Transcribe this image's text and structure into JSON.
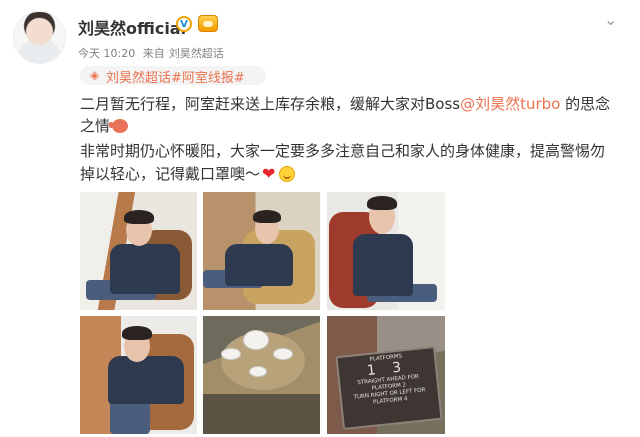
{
  "post": {
    "username": "刘昊然official",
    "verified_mark": "V",
    "meta": {
      "time": "今天 10:20",
      "from_label": "来自",
      "source": "刘昊然超话"
    },
    "topic_tag": "刘昊然超话#阿室线报#",
    "content": {
      "line1_before": "二月暂无行程，阿室赶来送上库存余粮，缓解大家对Boss",
      "mention": "@刘昊然turbo",
      "line1_after": " 的思念",
      "line2": "之情",
      "line3": "非常时期仍心怀暖阳，大家一定要多多注意自己和家人的身体健康，提高警惕勿",
      "line4": "掉以轻心，记得戴口罩噢～"
    },
    "photos": [
      {
        "name": "photo-1"
      },
      {
        "name": "photo-2"
      },
      {
        "name": "photo-3"
      },
      {
        "name": "photo-4"
      },
      {
        "name": "photo-5"
      },
      {
        "name": "photo-6"
      }
    ],
    "sign_text": {
      "title": "PLATFORMS",
      "numbers": "1 3",
      "line1": "STRAIGHT AHEAD FOR",
      "line2": "PLATFORM 2",
      "line3": "TURN RIGHT OR LEFT FOR",
      "line4": "PLATFORM 4"
    },
    "icons": {
      "avatar": "avatar",
      "verified": "verified-icon",
      "vip": "vip-badge-icon",
      "menu": "chevron-down-icon",
      "topic": "super-topic-icon"
    },
    "colors": {
      "link": "#eb7350",
      "meta": "#808080",
      "text": "#333333"
    }
  }
}
